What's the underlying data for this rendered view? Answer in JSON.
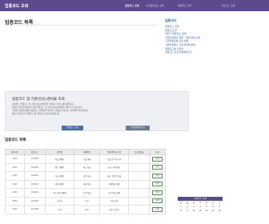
{
  "header": {
    "brand": "업종코드 조회",
    "nav": [
      "업종코드 조회",
      "주요업종코드 조회",
      "업종코드 찾기",
      "기관코드 조회"
    ]
  },
  "main": {
    "title": "업종코드 목록"
  },
  "sidebar": {
    "title": "업종코드",
    "items": [
      "업종코드 조회",
      "업종코드란?",
      "이런거 업종코드 분류",
      "사업자등록의 업종 · 업태 분류 필요",
      "기관업종등록 또는 분류",
      "사업자등록시 기준경비율 분류",
      "업종코드별 사업장",
      "업종코드 표준산업분류코드"
    ]
  },
  "info": {
    "title": "업종코드 및 기준(단순)경비율 조회",
    "lines": [
      "귀속연도 업종코드 및 기준(단순)경비율을 조회할 수 있는 페이지입니다.",
      "업종코드를 입력하시면 관련 업종코드 및 기준(단순)경비율을 확인할 수 있습니다.",
      "국세청 홈페이지에서 제공하는 경비율을 확인하고 업종코드에 맞는 경비율을 확인하세요.",
      "해당 귀속연도의 업종코드와 경비율 정보를 제공합니다."
    ],
    "button_primary": "업종코드 찾기",
    "button_secondary": "기준경비율 찾기"
  },
  "table": {
    "title": "업종코드 목록",
    "columns": [
      "귀속년도",
      "업종코드",
      "업종명",
      "세세분류",
      "적용범위 및 기준",
      "단순경비율",
      "조회"
    ],
    "rows": [
      [
        "2023",
        "011000",
        "작물 재배업",
        "곡물 재배",
        "곡물 및 기타 식량",
        "-",
        "상세"
      ],
      [
        "2023",
        "011001",
        "채소 재배업",
        "채소 작물",
        "채소, 화훼작물",
        "-",
        "상세"
      ],
      [
        "2023",
        "011002",
        "과실 재배업",
        "과실 작물",
        "과실, 음료용 작물",
        "-",
        "상세"
      ],
      [
        "2023",
        "011003",
        "화훼 재배업",
        "화훼 작물",
        "화훼작물 재배",
        "-",
        "상세"
      ],
      [
        "2023",
        "011004",
        "기타 작물 재배업",
        "기타 작물",
        "기타 작물 재배",
        "-",
        "상세"
      ],
      [
        "2023",
        "011005",
        "축산업",
        "축산",
        "가축 사육",
        "-",
        "상세"
      ],
      [
        "2023",
        "011006",
        "임업",
        "임업",
        "영림 및 벌목",
        "-",
        "상세"
      ]
    ]
  },
  "calendar": {
    "title": "2023년 12월",
    "days": [
      "일",
      "월",
      "화",
      "수",
      "목",
      "금",
      "토",
      "1",
      "2",
      "3",
      "4",
      "5",
      "6",
      "7",
      "8",
      "9",
      "10",
      "11",
      "12",
      "13",
      "14"
    ]
  },
  "colors": {
    "topbar": "#5b4a8c",
    "link": "#3a63a8",
    "button": "#4a6fa5"
  }
}
